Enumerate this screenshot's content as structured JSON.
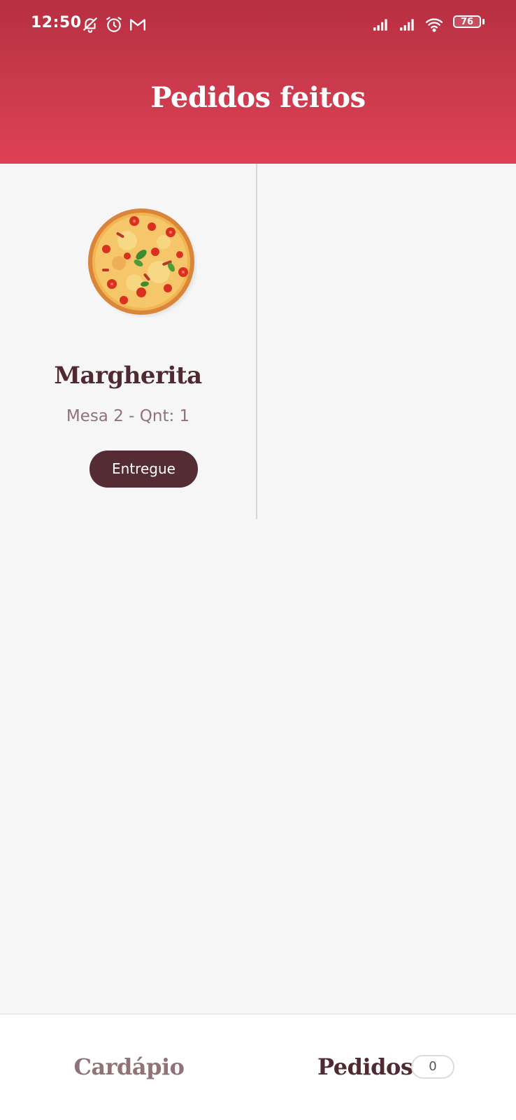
{
  "status_bar": {
    "time": "12:50",
    "battery": "76",
    "icons": [
      "notifications-off-icon",
      "alarm-icon",
      "gmail-icon",
      "signal-icon",
      "signal-icon",
      "wifi-icon",
      "battery-icon"
    ]
  },
  "header": {
    "title": "Pedidos feitos",
    "gradient_colors": [
      "#b72f41",
      "#df4055"
    ]
  },
  "orders": [
    {
      "image_icon": "pizza-image",
      "name": "Margherita",
      "details": "Mesa 2 - Qnt: 1",
      "status_label": "Entregue"
    }
  ],
  "bottom_nav": {
    "menu_label": "Cardápio",
    "orders_label": "Pedidos",
    "orders_count": "0"
  },
  "colors": {
    "accent_dark": "#552c33",
    "text_dark": "#4f2a33",
    "text_muted": "#8f7378",
    "background": "#f6f6f6"
  }
}
